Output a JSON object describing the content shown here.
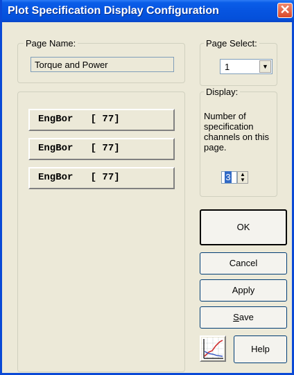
{
  "window": {
    "title": "Plot Specification Display Configuration",
    "close_glyph": "✕"
  },
  "page_name": {
    "legend": "Page Name:",
    "value": "Torque and Power"
  },
  "page_select": {
    "legend": "Page Select:",
    "value": "1",
    "arrow_glyph": "▼"
  },
  "channels": [
    {
      "label": "EngBor   [ 77]"
    },
    {
      "label": "EngBor   [ 77]"
    },
    {
      "label": "EngBor   [ 77]"
    }
  ],
  "display": {
    "legend": "Display:",
    "description": "Number of specification channels on this page.",
    "count": "3",
    "spin_up": "▲",
    "spin_down": "▼"
  },
  "buttons": {
    "ok": "OK",
    "cancel": "Cancel",
    "apply": "Apply",
    "save_prefix": "",
    "save_underlined": "S",
    "save_rest": "ave",
    "help": "Help"
  },
  "icons": {
    "plot": "plot-chart-icon"
  },
  "colors": {
    "titlebar": "#0654e0",
    "selection": "#316ac5",
    "plot_line": "#d03030"
  }
}
